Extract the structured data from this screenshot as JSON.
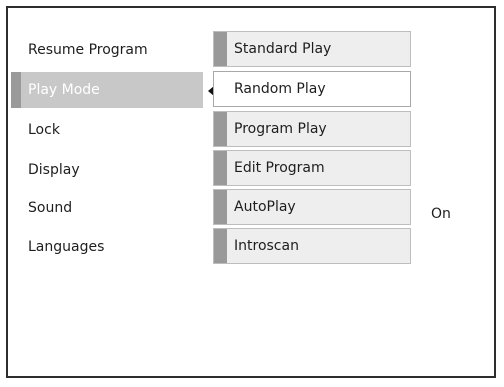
{
  "main_menu": {
    "items": [
      {
        "label": "Resume Program",
        "selected": false
      },
      {
        "label": "Play Mode",
        "selected": true
      },
      {
        "label": "Lock",
        "selected": false
      },
      {
        "label": "Display",
        "selected": false
      },
      {
        "label": "Sound",
        "selected": false
      },
      {
        "label": "Languages",
        "selected": false
      }
    ]
  },
  "submenu": {
    "items": [
      {
        "label": "Standard Play",
        "selected": false
      },
      {
        "label": "Random Play",
        "selected": true
      },
      {
        "label": "Program Play",
        "selected": false
      },
      {
        "label": "Edit Program",
        "selected": false
      },
      {
        "label": "AutoPlay",
        "selected": false,
        "value": "On"
      },
      {
        "label": "Introscan",
        "selected": false
      }
    ]
  },
  "colors": {
    "highlight_background": "#c8c8c8",
    "highlight_bar": "#9a9a9a",
    "submenu_bar": "#999999",
    "submenu_background": "#eeeeee",
    "selected_background": "#ffffff"
  }
}
